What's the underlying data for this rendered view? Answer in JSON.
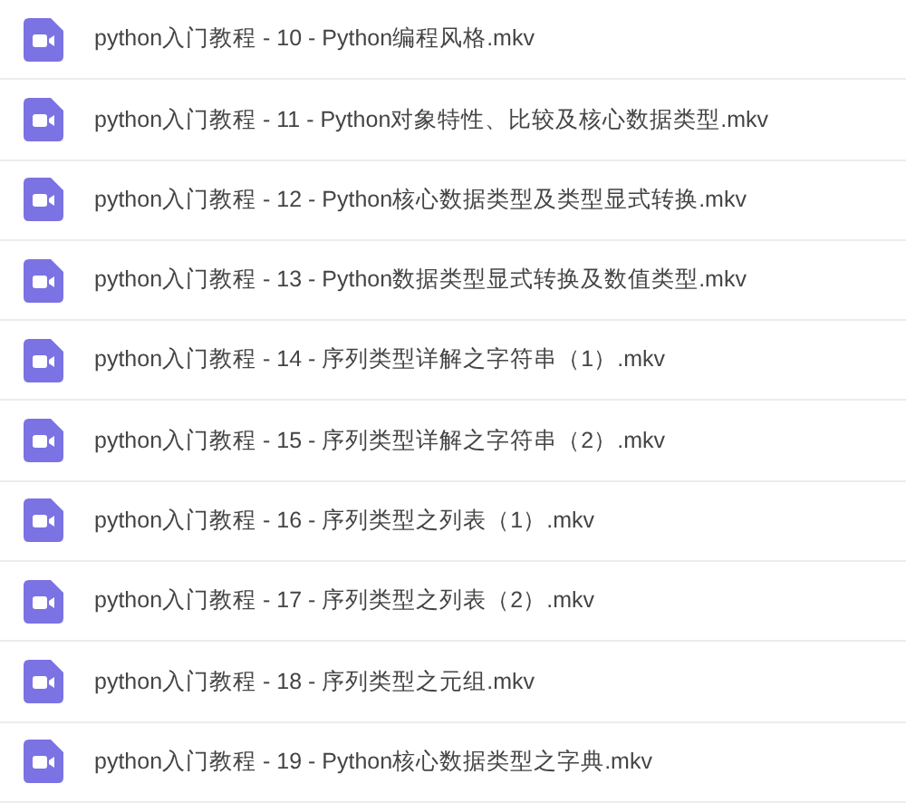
{
  "files": [
    {
      "name": "python入门教程 - 10 - Python编程风格.mkv"
    },
    {
      "name": "python入门教程 - 11 - Python对象特性、比较及核心数据类型.mkv"
    },
    {
      "name": "python入门教程 - 12 - Python核心数据类型及类型显式转换.mkv"
    },
    {
      "name": "python入门教程 - 13 - Python数据类型显式转换及数值类型.mkv"
    },
    {
      "name": "python入门教程 - 14 - 序列类型详解之字符串（1）.mkv"
    },
    {
      "name": "python入门教程 - 15 - 序列类型详解之字符串（2）.mkv"
    },
    {
      "name": "python入门教程 - 16 - 序列类型之列表（1）.mkv"
    },
    {
      "name": "python入门教程 - 17 - 序列类型之列表（2）.mkv"
    },
    {
      "name": "python入门教程 - 18 - 序列类型之元组.mkv"
    },
    {
      "name": "python入门教程 - 19 - Python核心数据类型之字典.mkv"
    }
  ]
}
